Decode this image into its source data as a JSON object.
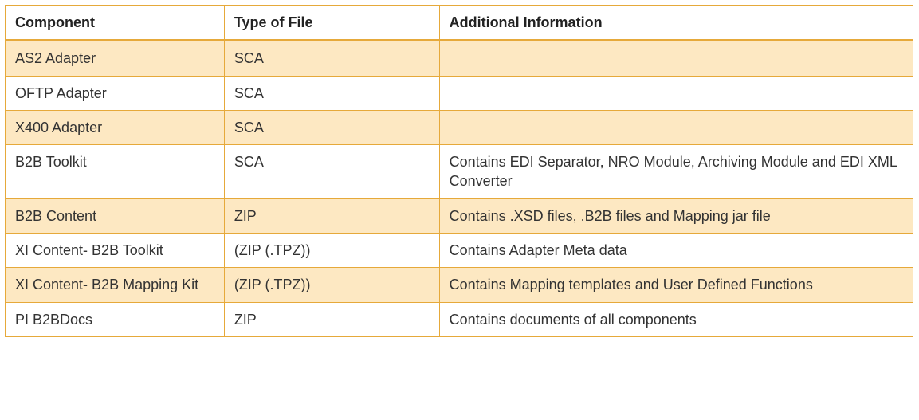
{
  "table": {
    "headers": [
      "Component",
      "Type of File",
      "Additional Information"
    ],
    "rows": [
      {
        "component": "AS2 Adapter",
        "type": "SCA",
        "info": ""
      },
      {
        "component": "OFTP Adapter",
        "type": "SCA",
        "info": ""
      },
      {
        "component": "X400 Adapter",
        "type": "SCA",
        "info": ""
      },
      {
        "component": "B2B Toolkit",
        "type": "SCA",
        "info": "Contains EDI Separator, NRO Module, Archiving Module and EDI XML Converter"
      },
      {
        "component": "B2B Content",
        "type": "ZIP",
        "info": "Contains .XSD files, .B2B files and Mapping jar file"
      },
      {
        "component": "XI Content- B2B Toolkit",
        "type": "(ZIP (.TPZ))",
        "info": "Contains Adapter Meta data"
      },
      {
        "component": "XI Content- B2B Mapping Kit",
        "type": "(ZIP (.TPZ))",
        "info": "Contains Mapping templates and User Defined Functions"
      },
      {
        "component": "PI B2BDocs",
        "type": "ZIP",
        "info": "Contains documents of all components"
      }
    ]
  }
}
